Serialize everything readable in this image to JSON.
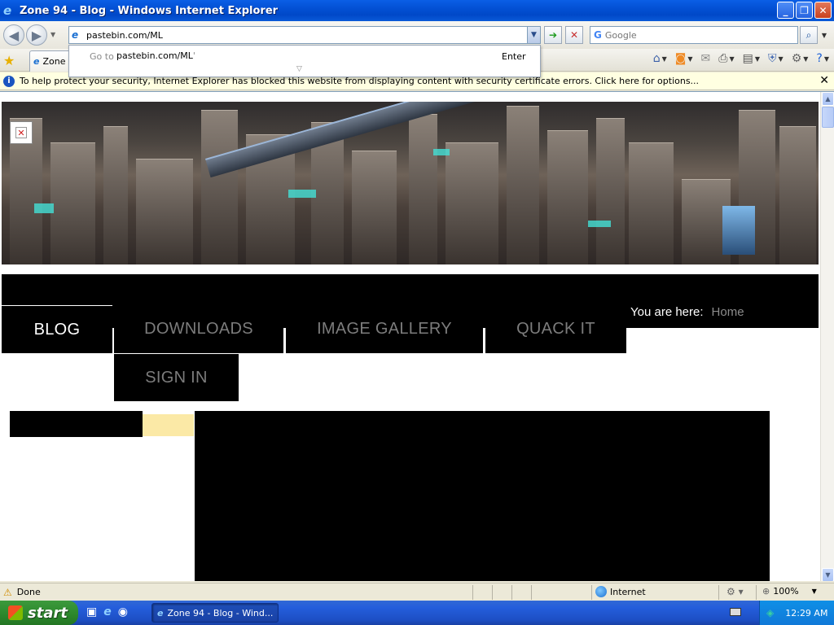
{
  "window": {
    "title": "Zone 94 - Blog - Windows Internet Explorer"
  },
  "address_bar": {
    "url": "pastebin.com/ML",
    "autocomplete_prefix": "Go to '",
    "autocomplete_url": "pastebin.com/ML",
    "autocomplete_suffix": "'",
    "autocomplete_hint": "Enter"
  },
  "search": {
    "placeholder": "Google"
  },
  "tab": {
    "label": "Zone"
  },
  "infobar": {
    "message": "To help protect your security, Internet Explorer has blocked this website from displaying content with security certificate errors. Click here for options..."
  },
  "site_nav": {
    "items": [
      {
        "label": "BLOG",
        "active": true
      },
      {
        "label": "DOWNLOADS",
        "active": false
      },
      {
        "label": "IMAGE GALLERY",
        "active": false
      },
      {
        "label": "QUACK IT",
        "active": false
      },
      {
        "label": "SIGN IN",
        "active": false
      }
    ],
    "breadcrumb_label": "You are here:",
    "breadcrumb_home": "Home"
  },
  "status_bar": {
    "status": "Done",
    "zone": "Internet",
    "zoom": "100%"
  },
  "taskbar": {
    "start_label": "start",
    "task_label": "Zone 94 - Blog - Wind...",
    "clock": "12:29 AM"
  },
  "colors": {
    "title_bar": "#0350d4",
    "nav_background": "#000000",
    "nav_text": "#7c7c7c",
    "nav_active_text": "#ffffff",
    "sidebar_accent": "#fbe9a6",
    "infobar_background": "#ffffe1",
    "taskbar": "#245ddb",
    "start_button": "#2e8a2e"
  }
}
